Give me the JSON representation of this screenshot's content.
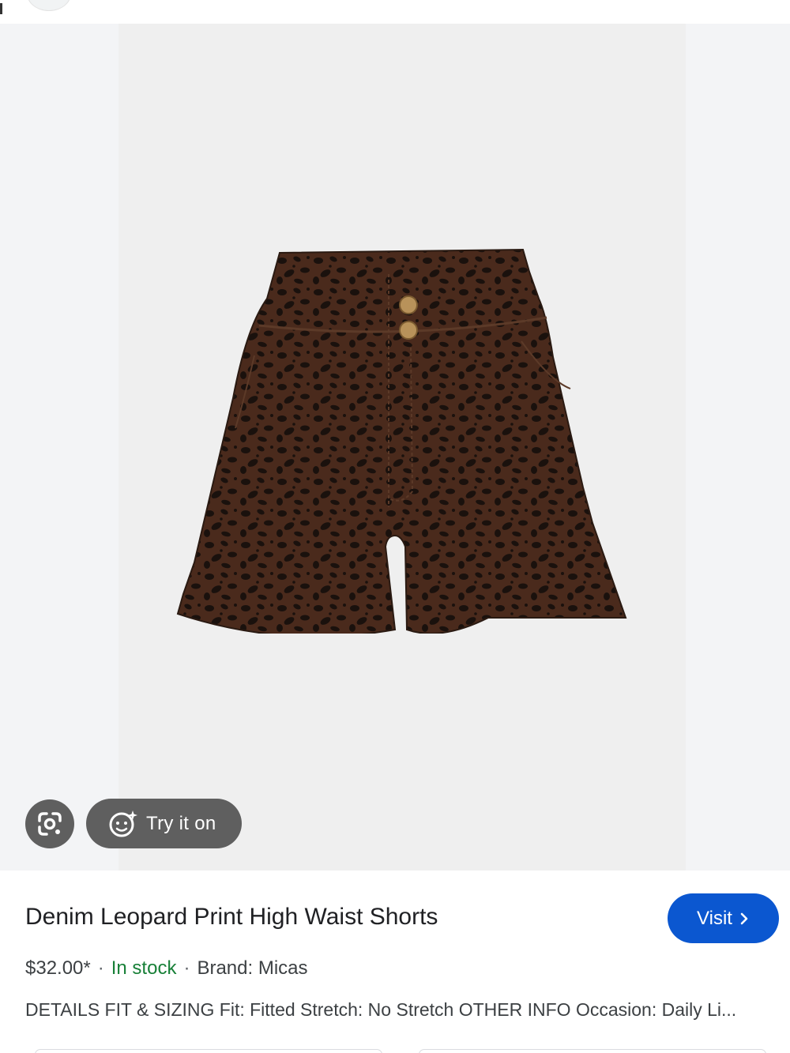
{
  "viewer": {
    "try_on_label": "Try it on",
    "lens_icon": "google-lens-icon",
    "try_on_icon": "face-sparkle-icon",
    "colors": {
      "leopard_base": "#4a2a1c",
      "leopard_spot": "#1a110d",
      "button_bg": "#5f5f5f"
    }
  },
  "product": {
    "title": "Denim Leopard Print High Waist Shorts",
    "price": "$32.00*",
    "separator": "·",
    "stock": "In stock",
    "brand": "Brand: Micas",
    "description": "DETAILS FIT & SIZING Fit: Fitted Stretch: No Stretch OTHER INFO Occasion: Daily Li...",
    "visit_label": "Visit",
    "colors": {
      "stock": "#188038",
      "visit_button": "#0b57d0"
    }
  }
}
